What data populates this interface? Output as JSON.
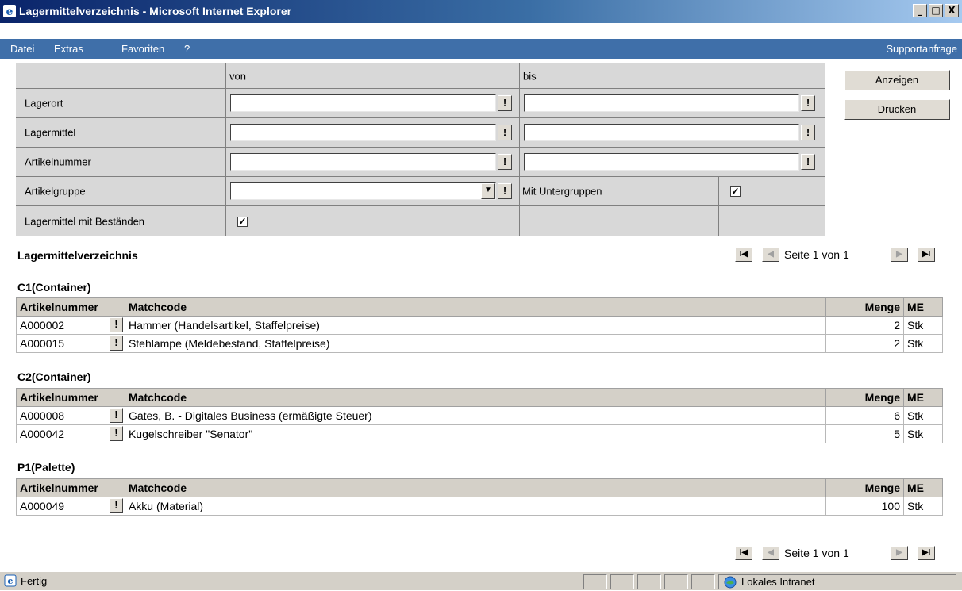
{
  "window": {
    "title": "Lagermittelverzeichnis - Microsoft Internet Explorer",
    "minimize": "_",
    "maximize": "□",
    "close": "X"
  },
  "menu": {
    "items": [
      "Datei",
      "Extras",
      "Favoriten",
      "?"
    ],
    "support": "Supportanfrage"
  },
  "filter": {
    "col_von": "von",
    "col_bis": "bis",
    "rows": {
      "lagerort": "Lagerort",
      "lagermittel": "Lagermittel",
      "artikelnummer": "Artikelnummer",
      "artikelgruppe": "Artikelgruppe",
      "mit_bestaenden": "Lagermittel mit Beständen"
    },
    "mit_untergruppen": "Mit Untergruppen",
    "mit_untergruppen_checked": true,
    "mit_bestaenden_checked": true,
    "bang": "!",
    "check_mark": "✓",
    "dropdown_icon": "▼"
  },
  "actions": {
    "anzeigen": "Anzeigen",
    "drucken": "Drucken"
  },
  "results": {
    "title": "Lagermittelverzeichnis",
    "pager_text": "Seite 1 von 1",
    "pager_first": "I◀",
    "pager_prev": "◀",
    "pager_next": "▶",
    "pager_last": "▶I",
    "headers": {
      "artikelnummer": "Artikelnummer",
      "matchcode": "Matchcode",
      "menge": "Menge",
      "me": "ME"
    },
    "groups": [
      {
        "name": "C1(Container)",
        "rows": [
          {
            "artikelnummer": "A000002",
            "matchcode": "Hammer (Handelsartikel, Staffelpreise)",
            "menge": "2",
            "me": "Stk"
          },
          {
            "artikelnummer": "A000015",
            "matchcode": "Stehlampe (Meldebestand, Staffelpreise)",
            "menge": "2",
            "me": "Stk"
          }
        ]
      },
      {
        "name": "C2(Container)",
        "rows": [
          {
            "artikelnummer": "A000008",
            "matchcode": "Gates, B. - Digitales Business (ermäßigte Steuer)",
            "menge": "6",
            "me": "Stk"
          },
          {
            "artikelnummer": "A000042",
            "matchcode": "Kugelschreiber \"Senator\"",
            "menge": "5",
            "me": "Stk"
          }
        ]
      },
      {
        "name": "P1(Palette)",
        "rows": [
          {
            "artikelnummer": "A000049",
            "matchcode": "Akku (Material)",
            "menge": "100",
            "me": "Stk"
          }
        ]
      }
    ]
  },
  "status": {
    "left": "Fertig",
    "zone": "Lokales Intranet"
  }
}
